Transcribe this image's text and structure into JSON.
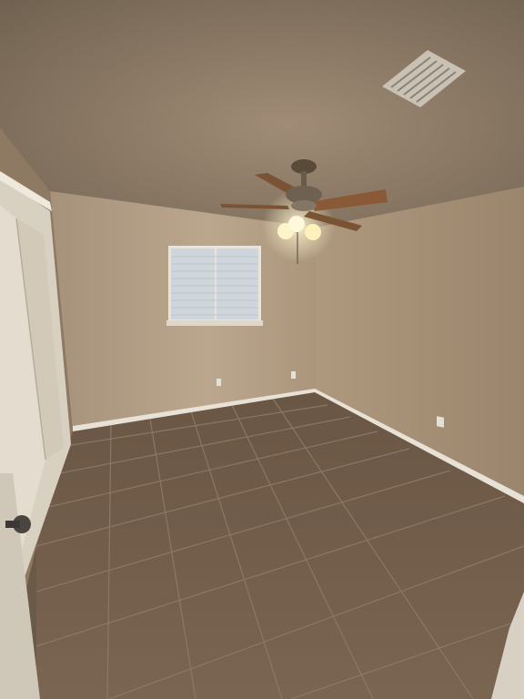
{
  "scene": {
    "description_free": true,
    "colors": {
      "ceiling": "#8e7b66",
      "wall_back": "#b3a088",
      "wall_right": "#a48e74",
      "wall_left": "#9c876f",
      "floor": "#6e5a47",
      "grout": "#8b7a68",
      "baseboard": "#e8e2d6",
      "door": "#d9d2c4",
      "window_glass": "#cfd6db",
      "fan_blade": "#8a5a38",
      "fan_light": "#fff4c8",
      "vent": "#c9c1b3"
    },
    "icons": [
      "ceiling-fan-icon",
      "air-vent-icon",
      "door-knob-icon",
      "power-outlet-icon"
    ]
  }
}
